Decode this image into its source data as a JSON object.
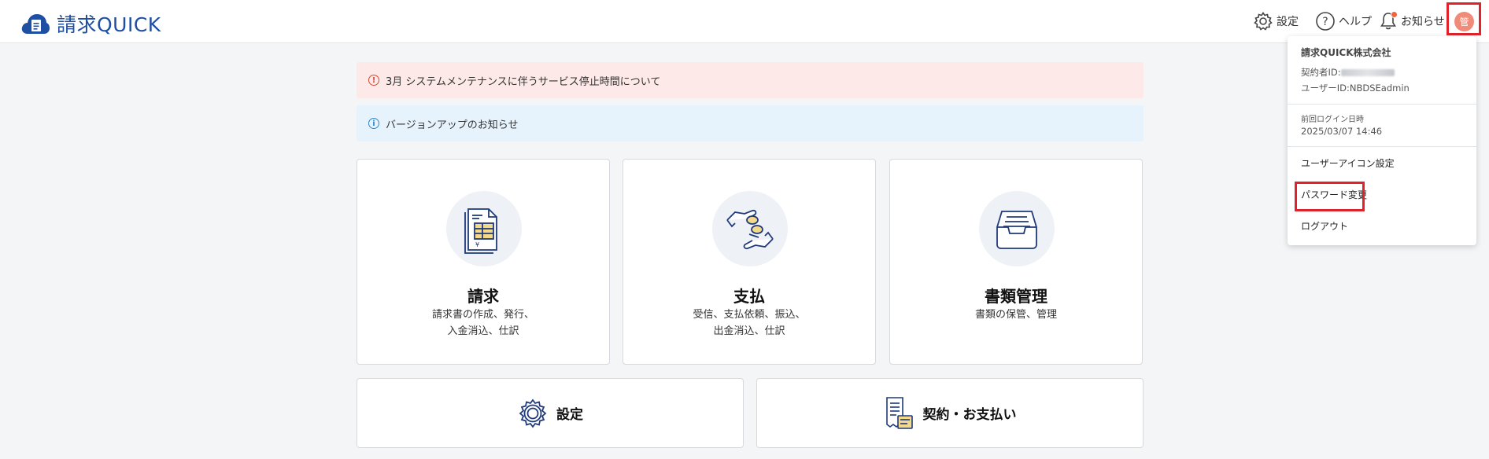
{
  "header": {
    "logo_text": "請求QUICK",
    "settings_label": "設定",
    "help_label": "ヘルプ",
    "notice_label": "お知らせ",
    "avatar_char": "管"
  },
  "notices": [
    {
      "text": "3月 システムメンテナンスに伴うサービス停止時間について",
      "color": "#fde9e7"
    },
    {
      "text": "バージョンアップのお知らせ",
      "color": "#e7f3fc"
    }
  ],
  "cards": [
    {
      "title": "請求",
      "desc_line1": "請求書の作成、発行、",
      "desc_line2": "入金消込、仕訳",
      "icon": "invoice-icon"
    },
    {
      "title": "支払",
      "desc_line1": "受信、支払依頼、振込、",
      "desc_line2": "出金消込、仕訳",
      "icon": "payment-hands-icon"
    },
    {
      "title": "書類管理",
      "desc_line1": "書類の保管、管理",
      "desc_line2": "",
      "icon": "document-tray-icon"
    }
  ],
  "small_cards": [
    {
      "title": "設定",
      "icon": "gear-icon"
    },
    {
      "title": "契約・お支払い",
      "icon": "contract-receipt-icon"
    }
  ],
  "user_menu": {
    "company": "請求QUICK株式会社",
    "contract_id_label": "契約者ID:",
    "user_id": "ユーザーID:NBDSEadmin",
    "last_login_label": "前回ログイン日時",
    "last_login_value": "2025/03/07 14:46",
    "items": [
      "ユーザーアイコン設定",
      "パスワード変更",
      "ログアウト"
    ]
  },
  "colors": {
    "brand": "#1f4fa3",
    "highlight": "#e0222b",
    "avatar": "#f08b7a"
  }
}
